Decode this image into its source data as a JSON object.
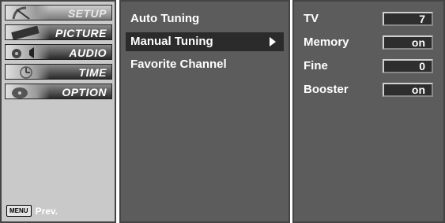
{
  "sidebar": {
    "items": [
      {
        "label": "SETUP",
        "icon": "satellite-dish-icon",
        "active": true
      },
      {
        "label": "PICTURE",
        "icon": "film-strip-icon",
        "active": false
      },
      {
        "label": "AUDIO",
        "icon": "speaker-icon",
        "active": false
      },
      {
        "label": "TIME",
        "icon": "clock-icon",
        "active": false
      },
      {
        "label": "OPTION",
        "icon": "option-disc-icon",
        "active": false
      }
    ],
    "footer": {
      "key_label": "MENU",
      "action_label": "Prev."
    }
  },
  "submenu": {
    "items": [
      {
        "label": "Auto Tuning",
        "selected": false
      },
      {
        "label": "Manual Tuning",
        "selected": true
      },
      {
        "label": "Favorite Channel",
        "selected": false
      }
    ]
  },
  "settings": {
    "rows": [
      {
        "label": "TV",
        "value": "7"
      },
      {
        "label": "Memory",
        "value": "on"
      },
      {
        "label": "Fine",
        "value": "0"
      },
      {
        "label": "Booster",
        "value": "on"
      }
    ]
  },
  "colors": {
    "panel": "#5c5c5c",
    "sidebar": "#c9c9c9",
    "highlight": "#2b2b2b"
  }
}
